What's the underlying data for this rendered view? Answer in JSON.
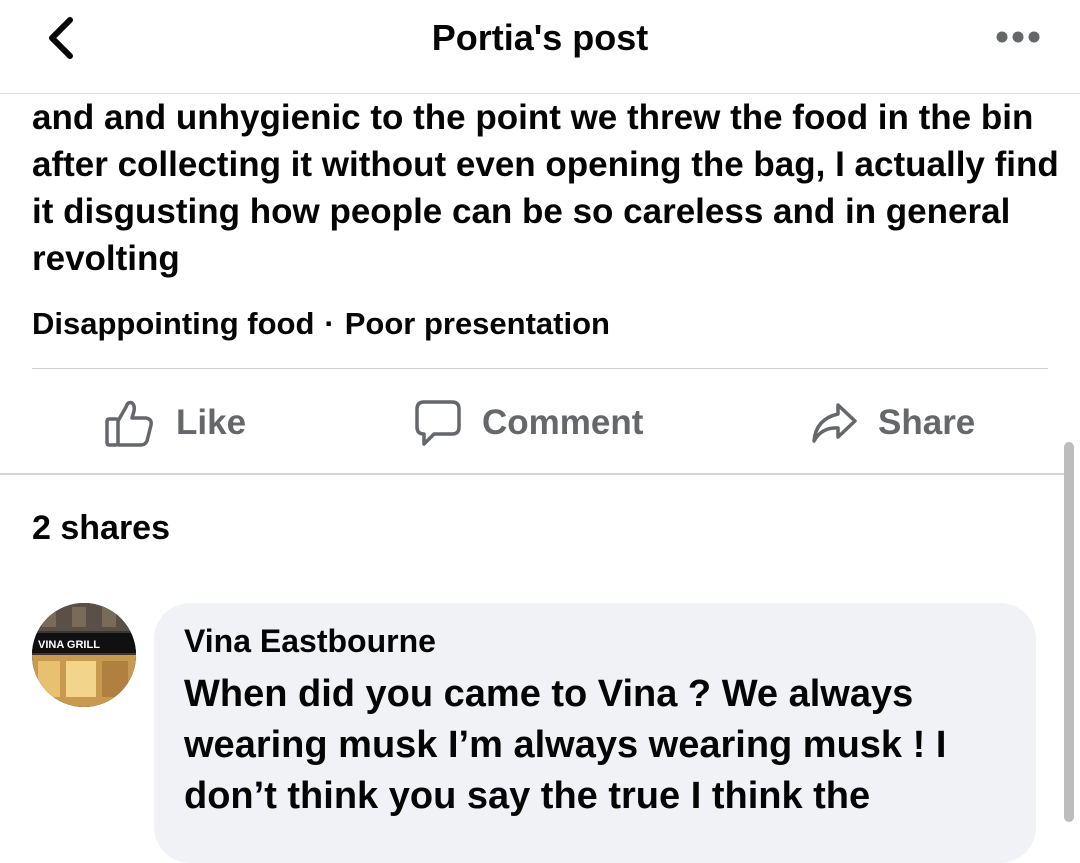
{
  "header": {
    "title": "Portia's post",
    "back_icon": "chevron-left-icon",
    "more_icon": "more-horizontal-icon"
  },
  "post": {
    "text": "and and unhygienic to the point we threw the food in the bin after collecting it without even opening the bag, I actually find it disgusting how people can be so careless and in general revolting",
    "tags": [
      "Disappointing food",
      "Poor presentation"
    ],
    "tag_separator": "·"
  },
  "actions": {
    "like": {
      "label": "Like",
      "icon": "thumbs-up-icon"
    },
    "comment": {
      "label": "Comment",
      "icon": "comment-bubble-icon"
    },
    "share": {
      "label": "Share",
      "icon": "share-arrow-icon"
    }
  },
  "shares_count": "2 shares",
  "comment": {
    "author": "Vina Eastbourne",
    "avatar_sign_text": "VINA GRILL",
    "text": "When did you came to Vina ? We always wearing musk I’m always wearing musk ! I don’t think you say the true I think the"
  },
  "colors": {
    "text": "#050505",
    "action_gray": "#65676b",
    "bubble_bg": "#f0f2f5",
    "divider": "#cfcfcf"
  }
}
